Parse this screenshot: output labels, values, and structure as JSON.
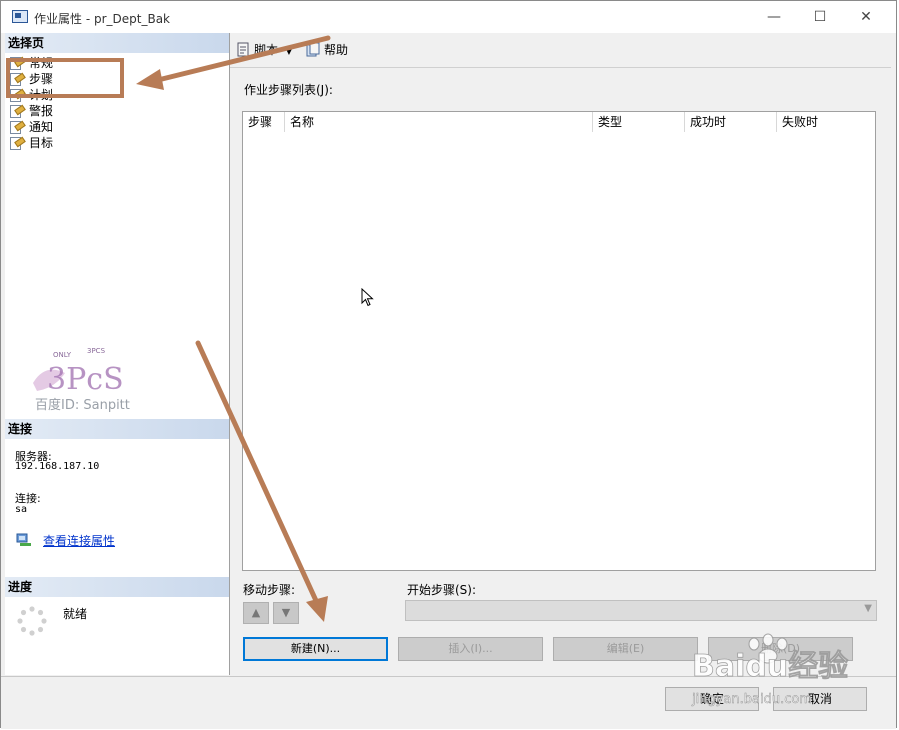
{
  "window": {
    "title": "作业属性 - pr_Dept_Bak",
    "minimize": "—",
    "maximize": "☐",
    "close": "✕"
  },
  "left": {
    "select_page_header": "选择页",
    "pages": [
      {
        "label": "常规",
        "icon": "page-icon"
      },
      {
        "label": "步骤",
        "icon": "page-icon"
      },
      {
        "label": "计划",
        "icon": "page-icon"
      },
      {
        "label": "警报",
        "icon": "page-icon"
      },
      {
        "label": "通知",
        "icon": "page-icon"
      },
      {
        "label": "目标",
        "icon": "page-icon"
      }
    ],
    "watermark": {
      "brand": "3PcS",
      "tag_only": "ONLY",
      "tag_pcs": "3PCS",
      "caption": "百度ID: Sanpitt"
    },
    "connection_header": "连接",
    "server_label": "服务器:",
    "server_value": "192.168.187.10",
    "connection_label": "连接:",
    "connection_value": "sa",
    "view_connection_link": "查看连接属性",
    "progress_header": "进度",
    "progress_status": "就绪"
  },
  "toolbar": {
    "script_label": "脚本",
    "help_label": "帮助"
  },
  "main": {
    "steps_list_label": "作业步骤列表(J):",
    "columns": [
      "步骤",
      "名称",
      "类型",
      "成功时",
      "失败时"
    ],
    "rows": [],
    "move_step_label": "移动步骤:",
    "move_up": "▲",
    "move_down": "▼",
    "start_step_label": "开始步骤(S):",
    "start_step_value": "",
    "buttons": {
      "new": "新建(N)...",
      "insert": "插入(I)...",
      "edit": "编辑(E)",
      "delete": "删除(D)"
    }
  },
  "footer": {
    "ok": "确定",
    "cancel": "取消"
  },
  "overlay": {
    "baidu_brand": "Baidu经验",
    "baidu_url": "jingyan.baidu.com",
    "annotation_color": "#b87c56"
  }
}
